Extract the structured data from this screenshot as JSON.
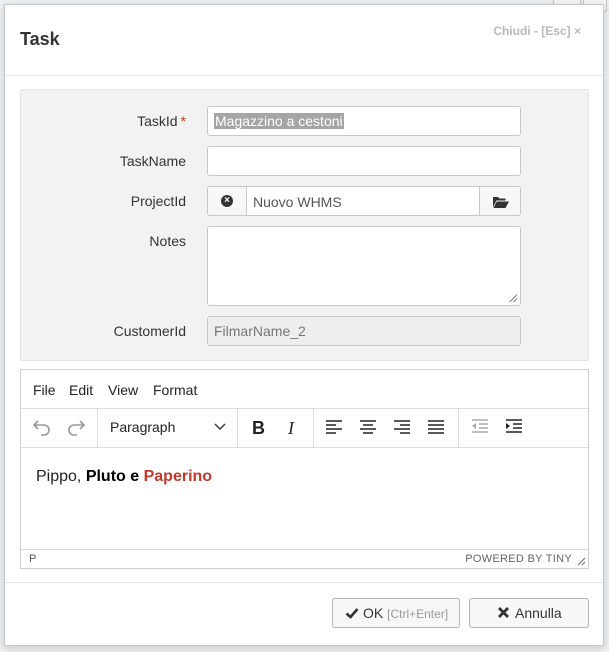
{
  "dialog": {
    "title": "Task",
    "close_label": "Chiudi - [Esc] ×"
  },
  "form": {
    "taskid_label": "TaskId",
    "taskid_required": "*",
    "taskid_value": "Magazzino a cestoni",
    "taskname_label": "TaskName",
    "taskname_value": "",
    "projectid_label": "ProjectId",
    "projectid_value": "Nuovo WHMS",
    "notes_label": "Notes",
    "notes_value": "",
    "customerid_label": "CustomerId",
    "customerid_value": "FilmarName_2"
  },
  "editor": {
    "menu": [
      "File",
      "Edit",
      "View",
      "Format"
    ],
    "block_format": "Paragraph",
    "content": {
      "plain": "Pippo, ",
      "bold": "Pluto e ",
      "red": "Paperino"
    },
    "path": "P",
    "powered_by": "POWERED BY TINY"
  },
  "footer": {
    "ok_label": "OK",
    "ok_hint": "[Ctrl+Enter]",
    "cancel_label": "Annulla"
  },
  "colors": {
    "required": "#c0392b",
    "highlight": "#c0392b",
    "selection": "#a5a5a5"
  }
}
